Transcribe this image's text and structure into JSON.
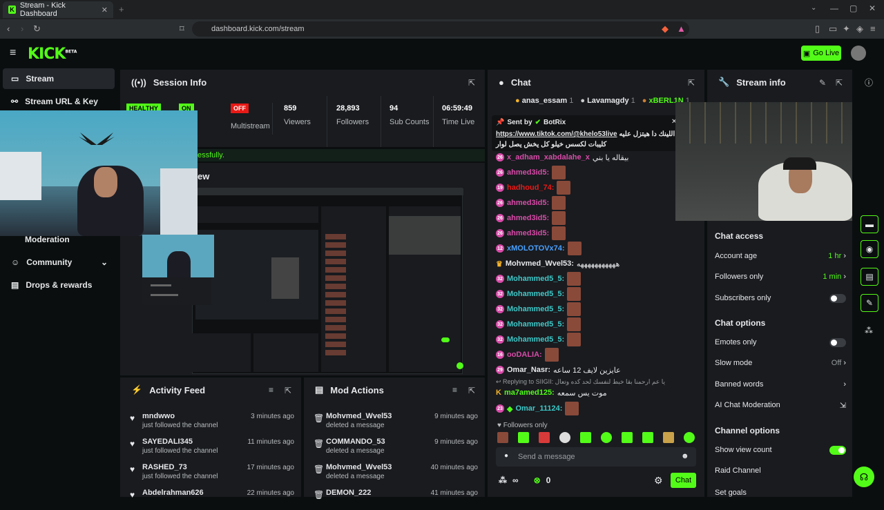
{
  "browser": {
    "tab_title": "Stream - Kick Dashboard",
    "url": "dashboard.kick.com/stream"
  },
  "header": {
    "logo": "KICK",
    "logo_sup": "BETA",
    "go_live": "Go Live"
  },
  "sidebar": {
    "items": [
      {
        "label": "Stream"
      },
      {
        "label": "Stream URL & Key"
      },
      {
        "label": "Moderation"
      },
      {
        "label": "Community"
      },
      {
        "label": "Drops & rewards"
      }
    ]
  },
  "session": {
    "title": "Session Info",
    "healthy": "HEALTHY",
    "on": "ON",
    "off": "OFF",
    "multistream": "Multistream",
    "viewers_value": "859",
    "viewers_label": "Viewers",
    "followers_value": "28,893",
    "followers_label": "Followers",
    "subs_value": "94",
    "subs_label": "Sub Counts",
    "time_value": "06:59:49",
    "time_label": "Time Live",
    "partial_1": "er",
    "partial_2": "e",
    "success_partial": "essfully.",
    "preview_partial": "ew"
  },
  "activity": {
    "title": "Activity Feed",
    "rows": [
      {
        "name": "mndwwo",
        "desc": "just followed the channel",
        "time": "3 minutes ago"
      },
      {
        "name": "SAYEDALI345",
        "desc": "just followed the channel",
        "time": "11 minutes ago"
      },
      {
        "name": "RASHED_73",
        "desc": "just followed the channel",
        "time": "17 minutes ago"
      },
      {
        "name": "Abdelrahman626",
        "desc": "",
        "time": "22 minutes ago"
      }
    ]
  },
  "mod": {
    "title": "Mod Actions",
    "rows": [
      {
        "name": "Mohvmed_Wvel53",
        "desc": "deleted a message",
        "time": "9 minutes ago"
      },
      {
        "name": "COMMANDO_53",
        "desc": "deleted a message",
        "time": "9 minutes ago"
      },
      {
        "name": "Mohvmed_Wvel53",
        "desc": "deleted a message",
        "time": "40 minutes ago"
      },
      {
        "name": "DEMON_222",
        "desc": "",
        "time": "41 minutes ago"
      }
    ]
  },
  "chat": {
    "title": "Chat",
    "top": [
      {
        "name": "anas_essam",
        "count": "1"
      },
      {
        "name": "Lavamagdy",
        "count": "1"
      },
      {
        "name": "xBERL1N",
        "count": "1"
      }
    ],
    "pinned": {
      "sent_by": "Sent by",
      "bot": "BotRix",
      "link": "https://www.tiktok.com/@khelo53live",
      "link_suffix": "اللينك دا هيتزل عليه ////",
      "line2": "كليبات لكسس خيلو كل يخش يصل لوار"
    },
    "messages": [
      {
        "lvl": "26",
        "user": "x_adham_xabdalahe_x",
        "color": "#d84ba8",
        "text": "بيقاله يا بني"
      },
      {
        "lvl": "26",
        "user": "ahmed3id5:",
        "color": "#d84ba8",
        "text": ""
      },
      {
        "lvl": "19",
        "user": "hadhoud_74:",
        "color": "#e91916",
        "text": ""
      },
      {
        "lvl": "26",
        "user": "ahmed3id5:",
        "color": "#d84ba8",
        "text": ""
      },
      {
        "lvl": "26",
        "user": "ahmed3id5:",
        "color": "#d84ba8",
        "text": ""
      },
      {
        "lvl": "26",
        "user": "ahmed3id5:",
        "color": "#d84ba8",
        "text": ""
      },
      {
        "lvl": "12",
        "user": "xMOLOTOVx74:",
        "color": "#4aa0ff",
        "text": ""
      },
      {
        "lvl": "",
        "user": "Mohvmed_Wvel53:",
        "color": "#e6e8ea",
        "text": "هههههههههههه"
      },
      {
        "lvl": "32",
        "user": "Mohammed5_5:",
        "color": "#3ec8c8",
        "text": ""
      },
      {
        "lvl": "32",
        "user": "Mohammed5_5:",
        "color": "#3ec8c8",
        "text": ""
      },
      {
        "lvl": "32",
        "user": "Mohammed5_5:",
        "color": "#3ec8c8",
        "text": ""
      },
      {
        "lvl": "32",
        "user": "Mohammed5_5:",
        "color": "#3ec8c8",
        "text": ""
      },
      {
        "lvl": "32",
        "user": "Mohammed5_5:",
        "color": "#3ec8c8",
        "text": ""
      },
      {
        "lvl": "16",
        "user": "ooDALIA:",
        "color": "#d84ba8",
        "text": ""
      },
      {
        "lvl": "29",
        "user": "Omar_Nasr:",
        "color": "#e6e8ea",
        "text": "عايزين لايف 12 ساعه"
      }
    ],
    "reply_line": "Replying to SIIGII: يا عم ارحمنا بقا خبط لنفسك لحد كده وتعال",
    "reply_user": "ma7amed125:",
    "reply_text": "موت يس سمعه",
    "last_user": "Omar_11124:",
    "followers_only": "Followers only",
    "placeholder": "Send a message",
    "infinity": "∞",
    "zero": "0",
    "chat_btn": "Chat"
  },
  "streaminfo": {
    "title": "Stream info",
    "chat_access": "Chat access",
    "account_age": "Account age",
    "account_age_val": "1 hr",
    "followers_only": "Followers only",
    "followers_only_val": "1 min",
    "subscribers_only": "Subscribers only",
    "chat_options": "Chat options",
    "emotes_only": "Emotes only",
    "slow_mode": "Slow mode",
    "slow_mode_val": "Off",
    "banned_words": "Banned words",
    "ai_mod": "AI Chat Moderation",
    "channel_options": "Channel options",
    "show_view_count": "Show view count",
    "raid_channel": "Raid Channel",
    "partial": "Set goals"
  }
}
